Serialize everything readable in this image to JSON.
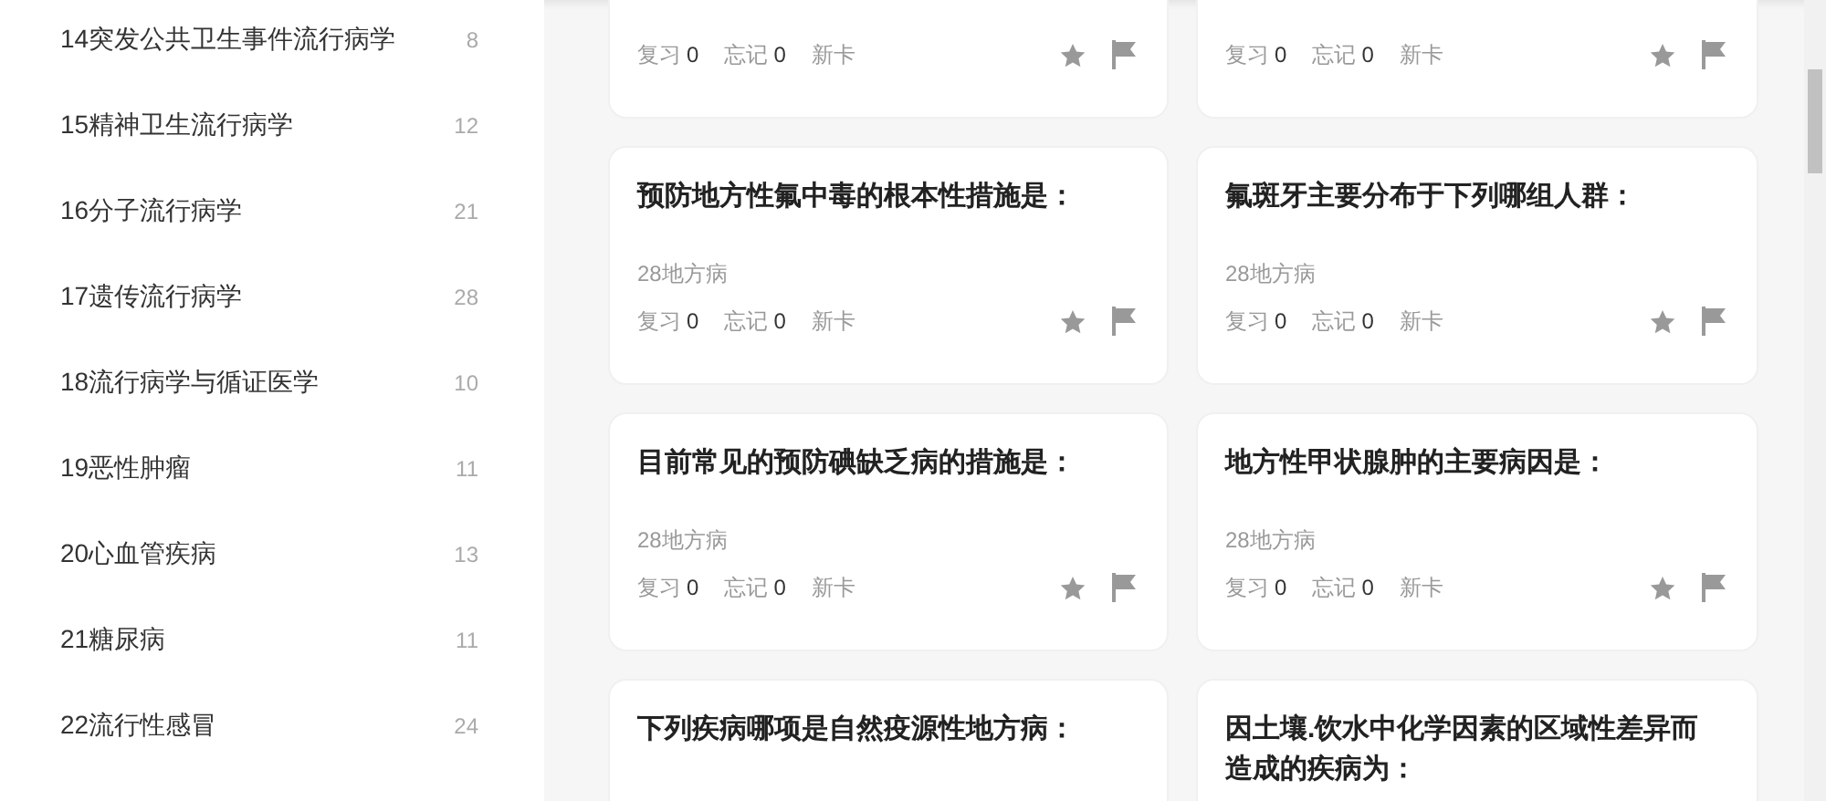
{
  "sidebar": {
    "items": [
      {
        "label": "14突发公共卫生事件流行病学",
        "count": "8"
      },
      {
        "label": "15精神卫生流行病学",
        "count": "12"
      },
      {
        "label": "16分子流行病学",
        "count": "21"
      },
      {
        "label": "17遗传流行病学",
        "count": "28"
      },
      {
        "label": "18流行病学与循证医学",
        "count": "10"
      },
      {
        "label": "19恶性肿瘤",
        "count": "11"
      },
      {
        "label": "20心血管疾病",
        "count": "13"
      },
      {
        "label": "21糖尿病",
        "count": "11"
      },
      {
        "label": "22流行性感冒",
        "count": "24"
      }
    ]
  },
  "cards": [
    {
      "review_label": "复习",
      "review_count": "0",
      "forget_label": "忘记",
      "forget_count": "0",
      "status": "新卡"
    },
    {
      "review_label": "复习",
      "review_count": "0",
      "forget_label": "忘记",
      "forget_count": "0",
      "status": "新卡"
    },
    {
      "question": "预防地方性氟中毒的根本性措施是：",
      "category": "28地方病",
      "review_label": "复习",
      "review_count": "0",
      "forget_label": "忘记",
      "forget_count": "0",
      "status": "新卡"
    },
    {
      "question": "氟斑牙主要分布于下列哪组人群：",
      "category": "28地方病",
      "review_label": "复习",
      "review_count": "0",
      "forget_label": "忘记",
      "forget_count": "0",
      "status": "新卡"
    },
    {
      "question": "目前常见的预防碘缺乏病的措施是：",
      "category": "28地方病",
      "review_label": "复习",
      "review_count": "0",
      "forget_label": "忘记",
      "forget_count": "0",
      "status": "新卡"
    },
    {
      "question": "地方性甲状腺肿的主要病因是：",
      "category": "28地方病",
      "review_label": "复习",
      "review_count": "0",
      "forget_label": "忘记",
      "forget_count": "0",
      "status": "新卡"
    },
    {
      "question": "下列疾病哪项是自然疫源性地方病："
    },
    {
      "question": "因土壤.饮水中化学因素的区域性差异而造成的疾病为："
    }
  ]
}
